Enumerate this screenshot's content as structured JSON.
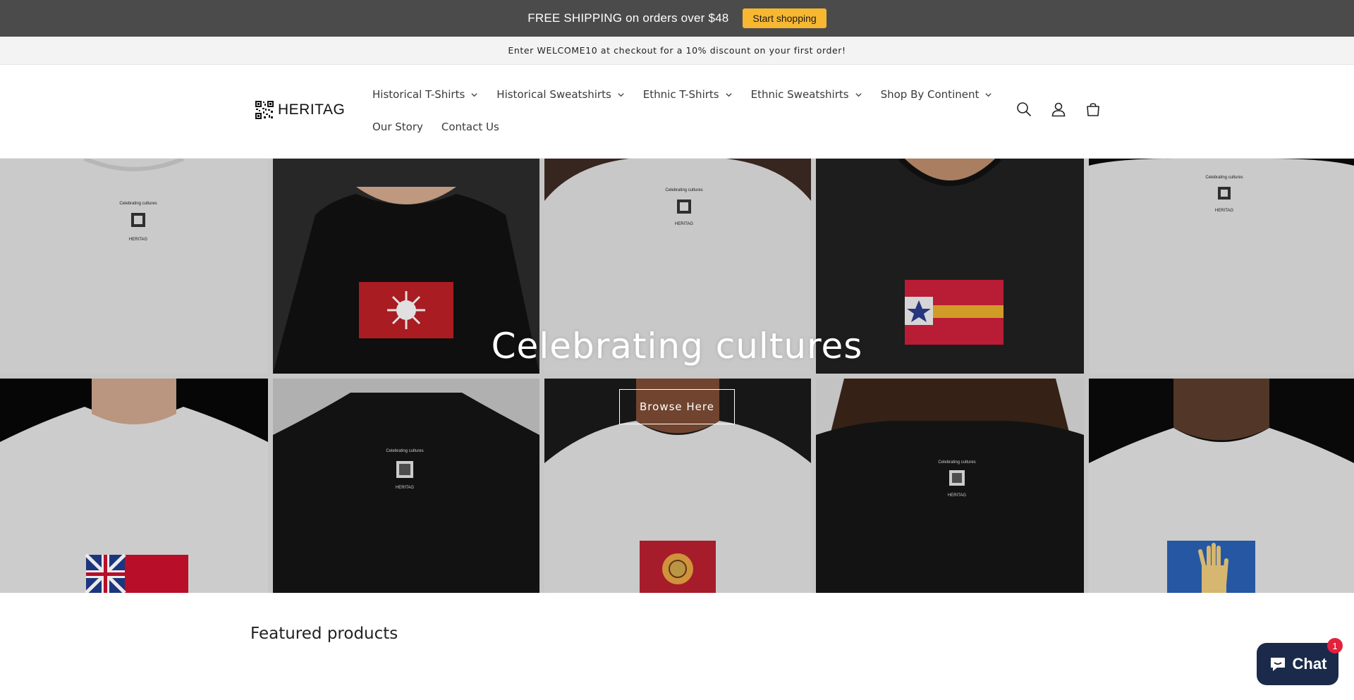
{
  "promo": {
    "text": "FREE SHIPPING on orders over $48",
    "button_label": "Start shopping",
    "button_color": "#f7b731"
  },
  "announcement": {
    "text": "Enter WELCOME10 at checkout for a 10% discount on your first order!"
  },
  "header": {
    "logo_text": "HERITAG",
    "nav_primary": [
      {
        "label": "Historical T-Shirts",
        "has_dropdown": true
      },
      {
        "label": "Historical Sweatshirts",
        "has_dropdown": true
      },
      {
        "label": "Ethnic T-Shirts",
        "has_dropdown": true
      },
      {
        "label": "Ethnic Sweatshirts",
        "has_dropdown": true
      },
      {
        "label": "Shop By Continent",
        "has_dropdown": true
      }
    ],
    "nav_secondary": [
      {
        "label": "Our Story"
      },
      {
        "label": "Contact Us"
      }
    ],
    "icons": [
      "search-icon",
      "account-icon",
      "cart-icon"
    ]
  },
  "hero": {
    "title": "Celebrating cultures",
    "button_label": "Browse Here",
    "shirt_print_text": "Celebrating cultures",
    "shirt_brand_text": "HERITAG"
  },
  "featured": {
    "title": "Featured products"
  },
  "chat": {
    "label": "Chat",
    "badge_count": "1",
    "color": "#1b2a4a"
  }
}
